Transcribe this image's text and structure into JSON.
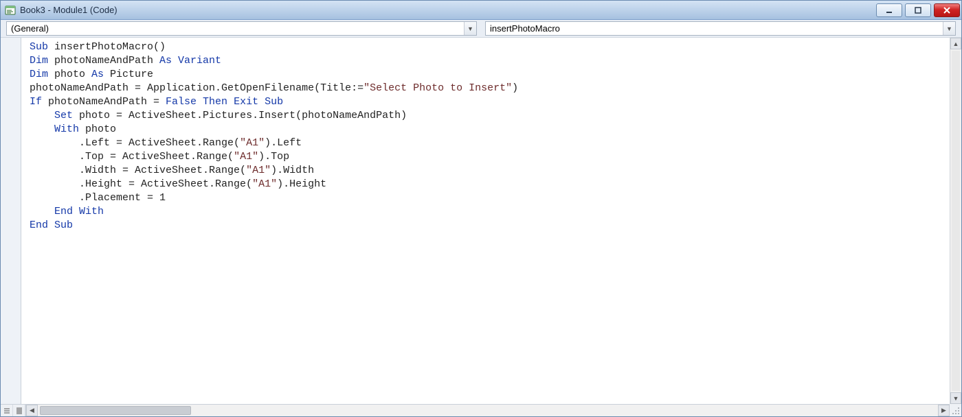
{
  "window": {
    "title": "Book3 - Module1 (Code)"
  },
  "dropdowns": {
    "object": "(General)",
    "procedure": "insertPhotoMacro"
  },
  "code": {
    "tokens": [
      [
        {
          "t": "Sub ",
          "c": "kw"
        },
        {
          "t": "insertPhotoMacro()"
        }
      ],
      [
        {
          "t": "Dim ",
          "c": "kw"
        },
        {
          "t": "photoNameAndPath "
        },
        {
          "t": "As Variant",
          "c": "kw"
        }
      ],
      [
        {
          "t": "Dim ",
          "c": "kw"
        },
        {
          "t": "photo "
        },
        {
          "t": "As ",
          "c": "kw"
        },
        {
          "t": "Picture"
        }
      ],
      [
        {
          "t": "photoNameAndPath = Application.GetOpenFilename(Title:="
        },
        {
          "t": "\"Select Photo to Insert\"",
          "c": "str"
        },
        {
          "t": ")"
        }
      ],
      [
        {
          "t": "If ",
          "c": "kw"
        },
        {
          "t": "photoNameAndPath = "
        },
        {
          "t": "False Then Exit Sub",
          "c": "kw"
        }
      ],
      [
        {
          "t": "    "
        },
        {
          "t": "Set ",
          "c": "kw"
        },
        {
          "t": "photo = ActiveSheet.Pictures.Insert(photoNameAndPath)"
        }
      ],
      [
        {
          "t": "    "
        },
        {
          "t": "With ",
          "c": "kw"
        },
        {
          "t": "photo"
        }
      ],
      [
        {
          "t": "        .Left = ActiveSheet.Range("
        },
        {
          "t": "\"A1\"",
          "c": "str"
        },
        {
          "t": ").Left"
        }
      ],
      [
        {
          "t": "        .Top = ActiveSheet.Range("
        },
        {
          "t": "\"A1\"",
          "c": "str"
        },
        {
          "t": ").Top"
        }
      ],
      [
        {
          "t": "        .Width = ActiveSheet.Range("
        },
        {
          "t": "\"A1\"",
          "c": "str"
        },
        {
          "t": ").Width"
        }
      ],
      [
        {
          "t": "        .Height = ActiveSheet.Range("
        },
        {
          "t": "\"A1\"",
          "c": "str"
        },
        {
          "t": ").Height"
        }
      ],
      [
        {
          "t": "        .Placement = 1"
        }
      ],
      [
        {
          "t": ""
        }
      ],
      [
        {
          "t": "    "
        },
        {
          "t": "End With",
          "c": "kw"
        }
      ],
      [
        {
          "t": "End Sub",
          "c": "kw"
        }
      ]
    ]
  },
  "icons": {
    "module": "module-icon",
    "minimize": "minimize-icon",
    "maximize": "maximize-icon",
    "close": "close-icon",
    "dropdown": "chevron-down-icon",
    "scroll_up": "scroll-up-icon",
    "scroll_down": "scroll-down-icon",
    "scroll_left": "scroll-left-icon",
    "scroll_right": "scroll-right-icon",
    "view_procedure": "view-procedure-icon",
    "view_full": "view-full-module-icon",
    "size_grip": "size-grip-icon"
  }
}
